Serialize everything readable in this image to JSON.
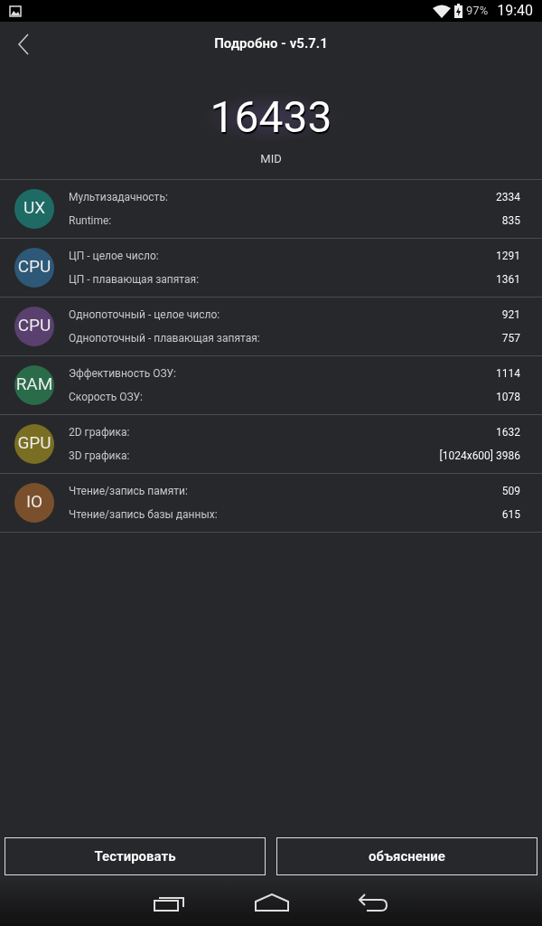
{
  "status_bar": {
    "battery": "97%",
    "time": "19:40"
  },
  "header": {
    "title": "Подробно - v5.7.1",
    "score": "16433",
    "tier": "MID"
  },
  "groups": [
    {
      "badge": "UX",
      "color": "#1e6b65",
      "items": [
        {
          "label": "Мультизадачность:",
          "value": "2334"
        },
        {
          "label": "Runtime:",
          "value": "835"
        }
      ]
    },
    {
      "badge": "CPU",
      "color": "#2e5877",
      "items": [
        {
          "label": "ЦП - целое число:",
          "value": "1291"
        },
        {
          "label": "ЦП - плавающая запятая:",
          "value": "1361"
        }
      ]
    },
    {
      "badge": "CPU",
      "color": "#5a406e",
      "items": [
        {
          "label": "Однопоточный - целое число:",
          "value": "921"
        },
        {
          "label": "Однопоточный - плавающая запятая:",
          "value": "757"
        }
      ]
    },
    {
      "badge": "RAM",
      "color": "#2a6b4a",
      "items": [
        {
          "label": "Эффективность ОЗУ:",
          "value": "1114"
        },
        {
          "label": "Скорость ОЗУ:",
          "value": "1078"
        }
      ]
    },
    {
      "badge": "GPU",
      "color": "#7a6e22",
      "items": [
        {
          "label": "2D графика:",
          "value": "1632"
        },
        {
          "label": "3D графика:",
          "value": "[1024x600] 3986"
        }
      ]
    },
    {
      "badge": "IO",
      "color": "#7a4f2c",
      "items": [
        {
          "label": "Чтение/запись памяти:",
          "value": "509"
        },
        {
          "label": "Чтение/запись базы данных:",
          "value": "615"
        }
      ]
    }
  ],
  "buttons": [
    "Тестировать",
    "объяснение"
  ]
}
